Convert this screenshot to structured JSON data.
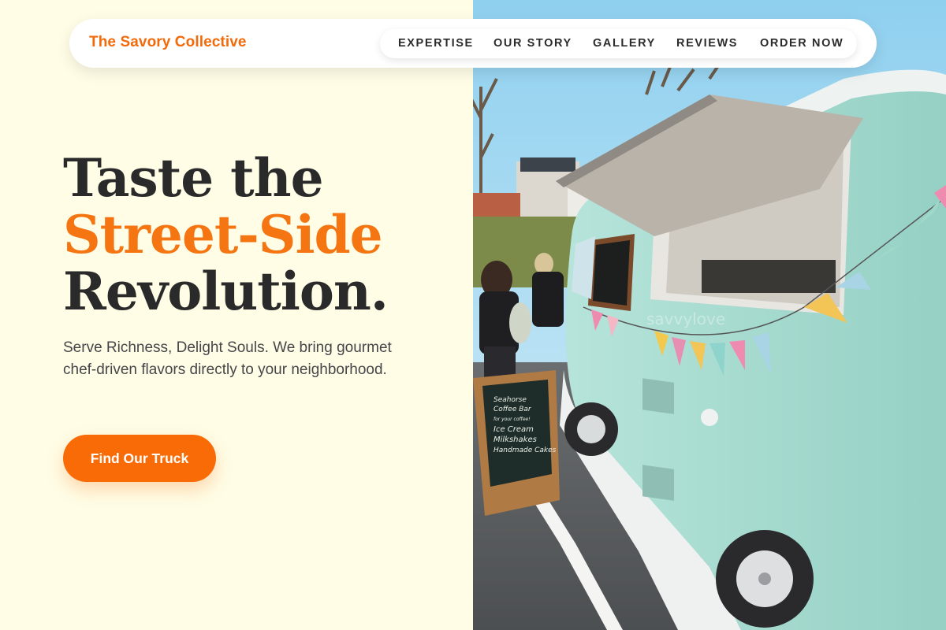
{
  "brand": {
    "name": "The Savory Collective"
  },
  "nav": {
    "items": [
      {
        "label": "EXPERTISE"
      },
      {
        "label": "OUR STORY"
      },
      {
        "label": "GALLERY"
      },
      {
        "label": "REVIEWS"
      },
      {
        "label": "ORDER NOW"
      }
    ]
  },
  "hero": {
    "title_line1": "Taste the",
    "title_line2": "Street-Side",
    "title_line3": "Revolution.",
    "subtitle": "Serve Richness, Delight Souls. We bring gourmet chef-driven flavors directly to your neighborhood.",
    "cta_label": "Find Our Truck"
  },
  "photo": {
    "chalkboard_lines": [
      "Seahorse",
      "Coffee Bar",
      "for your coffee!",
      "Ice Cream",
      "Milkshakes",
      "Handmade Cakes"
    ],
    "watermark": "savvylove"
  },
  "colors": {
    "accent": "#f96b06",
    "background": "#fffde6",
    "heading": "#2b2a2a",
    "truck": "#a9dcd0"
  }
}
